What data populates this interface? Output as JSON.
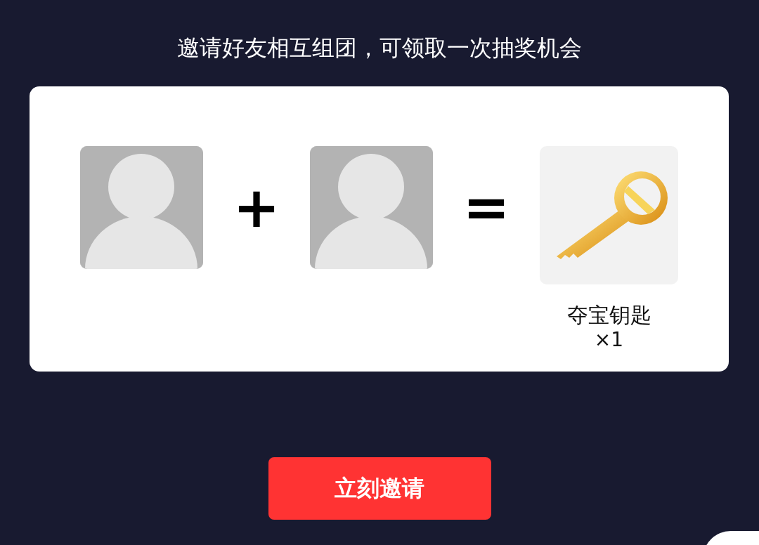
{
  "title": "邀请好友相互组团，可领取一次抽奖机会",
  "equation": [
    {
      "kind": "avatar"
    },
    {
      "kind": "operator",
      "symbol": "+"
    },
    {
      "kind": "avatar"
    },
    {
      "kind": "operator",
      "symbol": "="
    },
    {
      "kind": "reward",
      "name": "夺宝钥匙",
      "count": "×1"
    }
  ],
  "button": {
    "label": "立刻邀请"
  }
}
